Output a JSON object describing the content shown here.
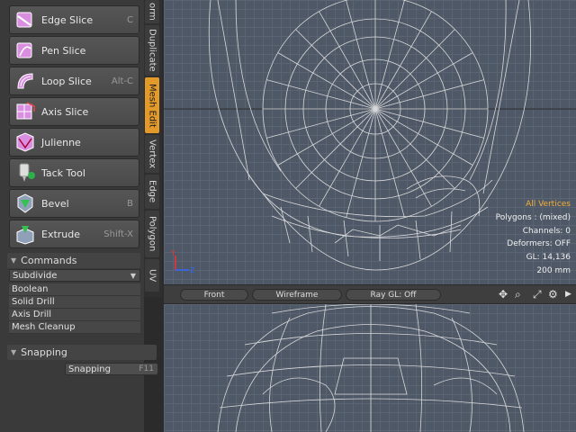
{
  "tools": [
    {
      "label": "Edge Slice",
      "key": "C",
      "icon": "edge-slice-icon"
    },
    {
      "label": "Pen Slice",
      "key": "",
      "icon": "pen-slice-icon"
    },
    {
      "label": "Loop Slice",
      "key": "Alt-C",
      "icon": "loop-slice-icon"
    },
    {
      "label": "Axis Slice",
      "key": "",
      "icon": "axis-slice-icon"
    },
    {
      "label": "Julienne",
      "key": "",
      "icon": "julienne-icon"
    },
    {
      "label": "Tack Tool",
      "key": "",
      "icon": "tack-tool-icon"
    },
    {
      "label": "Bevel",
      "key": "B",
      "icon": "bevel-icon"
    },
    {
      "label": "Extrude",
      "key": "Shift-X",
      "icon": "extrude-icon"
    }
  ],
  "commands": {
    "title": "Commands",
    "dropdown": "Subdivide",
    "items": [
      "Boolean",
      "Solid Drill",
      "Axis Drill",
      "Mesh Cleanup"
    ]
  },
  "snapping": {
    "title": "Snapping",
    "button": "Snapping",
    "key": "F11"
  },
  "tabs": [
    "orm",
    "Duplicate",
    "Mesh Edit",
    "Vertex",
    "Edge",
    "Polygon",
    "UV"
  ],
  "active_tab": "Mesh Edit",
  "viewport": {
    "view_label": "Front",
    "shading_label": "Wireframe",
    "render_label": "Ray GL: Off",
    "icons": [
      "move-view-icon",
      "zoom-view-icon",
      "fit-view-icon",
      "settings-gear-icon",
      "expand-arrow-icon"
    ]
  },
  "info": {
    "selection": "All Vertices",
    "polygons": "Polygons : (mixed)",
    "channels": "Channels: 0",
    "deformers": "Deformers: OFF",
    "gl": "GL: 14,136",
    "scale": "200 mm"
  },
  "colors": {
    "active_tab": "#e39a2b",
    "info_highlight": "#f2b035",
    "viewport_bg": "#4f5866",
    "wireframe": "#e6e6e6"
  }
}
